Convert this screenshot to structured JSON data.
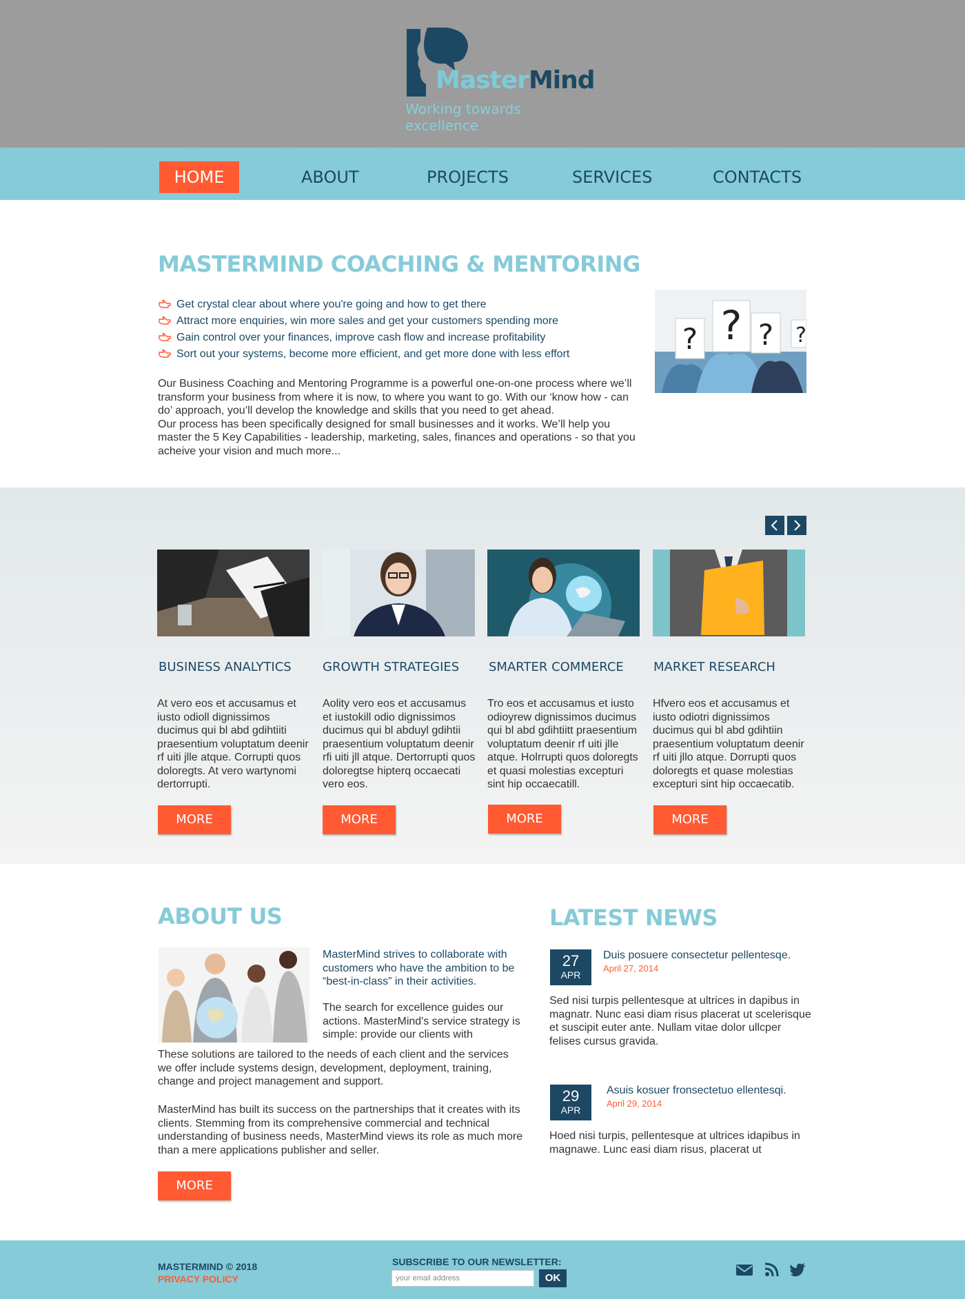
{
  "brand": {
    "logo_word_1": "Master",
    "logo_word_2": "Mind",
    "tagline": "Working towards excellence"
  },
  "nav": {
    "items": [
      "HOME",
      "ABOUT",
      "PROJECTS",
      "SERVICES",
      "CONTACTS"
    ],
    "active": "HOME"
  },
  "intro": {
    "title": "MASTERMIND COACHING & MENTORING",
    "bullets": [
      "Get crystal clear about where you're going and how to get there",
      "Attract more enquiries, win more sales and get your customers spending more",
      "Gain control over your finances, improve cash flow and increase profitability",
      "Sort out your systems, become more efficient, and get more done with less effort"
    ],
    "paragraph_1": "Our Business Coaching and Mentoring Programme is a powerful one-on-one process where we’ll transform your business from where it is now, to where you want to go. With our ‘know how - can do’ approach, you’ll develop the knowledge and skills that you need to get ahead.",
    "paragraph_2": "Our process has been specifically designed for small businesses and it works. We’ll help you master the 5 Key Capabilities - leadership, marketing, sales, finances and operations - so that you acheive your vision and much more..."
  },
  "services": {
    "items": [
      {
        "title": "BUSINESS ANALYTICS",
        "text": "At vero eos et accusamus et iusto odioll dignissimos ducimus qui bl abd gdihtiiti praesentium voluptatum deenir rf uiti jlle atque. Corrupti quos doloregts. At vero wartynomi dertorrupti.",
        "button": "MORE"
      },
      {
        "title": "GROWTH STRATEGIES",
        "text": "Aolity vero eos et accusamus et iustokill odio dignissimos ducimus qui bl abduyl gdihtii praesentium voluptatum deenir rfi uiti jll atque. Dertorrupti quos doloregtse hipterq occaecati vero eos.",
        "button": "MORE"
      },
      {
        "title": "SMARTER COMMERCE",
        "text": "Tro eos et accusamus et iusto odioyrew dignissimos ducimus qui bl abd gdihtiitt praesentium voluptatum deenir rf uiti jlle atque. Holrrupti quos doloregts et quasi molestias excepturi sint hip occaecatill.",
        "button": "MORE"
      },
      {
        "title": "MARKET RESEARCH",
        "text": "Hfvero eos et accusamus et iusto odiotri dignissimos ducimus qui bl abd gdihtiin praesentium voluptatum deenir rf uiti jllo atque. Dorrupti quos doloregts et quase molestias excepturi sint hip occaecatib.",
        "button": "MORE"
      }
    ]
  },
  "about": {
    "title": "ABOUT US",
    "lead": "MasterMind strives to collaborate with customers who have the ambition to be “best-in-class” in their activities.",
    "p2": "The search for excellence guides our actions. MasterMind's service strategy is simple: provide our clients with",
    "p3": "These solutions are tailored to the needs of each client and the services we offer include systems design, development, deployment, training, change and project management and support.",
    "p4": "MasterMind has built its success on the partnerships that it creates with its clients. Stemming from its comprehensive commercial and technical understanding of business needs, MasterMind views its role as much more than a mere applications publisher and seller.",
    "button": "MORE"
  },
  "news": {
    "title": "LATEST NEWS",
    "items": [
      {
        "day": "27",
        "month": "APR",
        "title": "Duis posuere consectetur pellentesqe.",
        "date": "April 27, 2014",
        "text": "Sed nisi turpis pellentesque at ultrices in dapibus in magnatr. Nunc easi diam risus placerat ut scelerisque et suscipit euter ante. Nullam vitae dolor ullcper felises cursus gravida."
      },
      {
        "day": "29",
        "month": "APR",
        "title": "Asuis kosuer fronsectetuo ellentesqi.",
        "date": "April 29, 2014",
        "text": "Hoed nisi turpis, pellentesque at ultrices idapibus in magnawe. Lunc easi diam risus, placerat ut"
      }
    ]
  },
  "footer": {
    "copyright": "MASTERMIND © 2018",
    "privacy": "PRIVACY POLICY",
    "newsletter_label": "SUBSCRIBE TO OUR NEWSLETTER:",
    "email_placeholder": "your email address",
    "ok": "OK",
    "social": [
      "mail-icon",
      "rss-icon",
      "twitter-icon"
    ]
  },
  "colors": {
    "accent": "#ff5a32",
    "primary": "#1c4863",
    "light_blue": "#86cbd8"
  }
}
